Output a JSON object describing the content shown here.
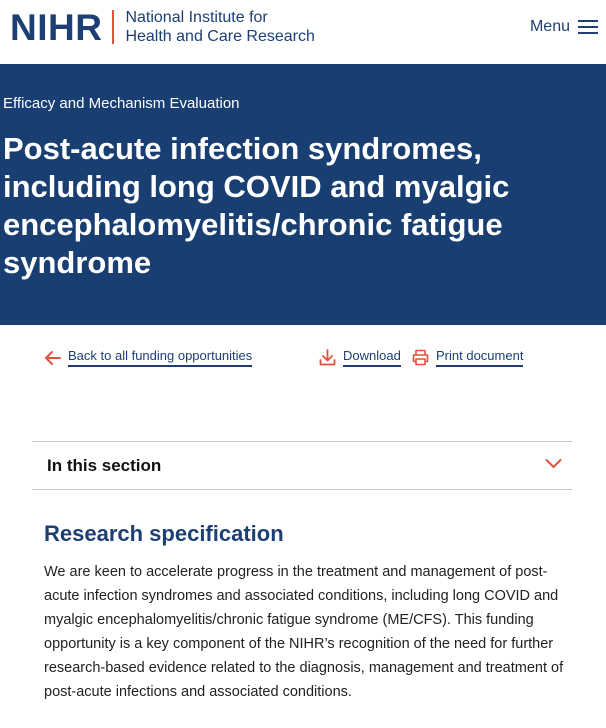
{
  "header": {
    "logo_mark": "NIHR",
    "logo_line1": "National Institute for",
    "logo_line2": "Health and Care Research",
    "menu_label": "Menu"
  },
  "hero": {
    "eyebrow": "Efficacy and Mechanism Evaluation",
    "title": "Post-acute infection syndromes, including long COVID and myalgic encephalomyelitis/chronic fatigue syndrome"
  },
  "actions": {
    "back_label": "Back to all funding opportunities",
    "download_label": "Download",
    "print_label": "Print document"
  },
  "section": {
    "label": "In this section"
  },
  "content": {
    "heading": "Research specification",
    "body": "We are keen to accelerate progress in the treatment and management of post-acute infection syndromes and associated conditions, including long COVID and myalgic encephalomyelitis/chronic fatigue syndrome (ME/CFS). This funding opportunity is a key component of the NIHR’s recognition of the need for further research-based evidence related to the diagnosis, management and treatment of post-acute infections and associated conditions."
  },
  "colors": {
    "brand_navy": "#193e72",
    "accent_red": "#e0523e"
  },
  "icons": [
    "hamburger-icon",
    "arrow-left-icon",
    "download-icon",
    "printer-icon",
    "chevron-down-icon"
  ]
}
